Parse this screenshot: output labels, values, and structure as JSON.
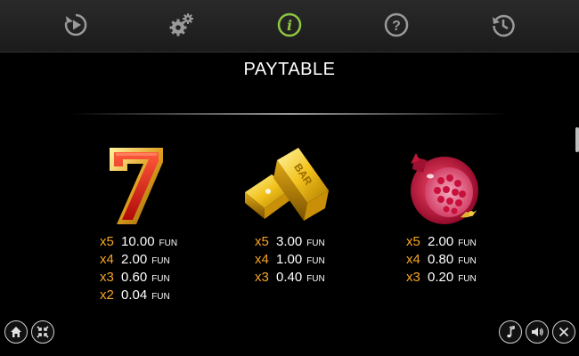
{
  "tabs": [
    {
      "icon": "replay-icon",
      "active": false
    },
    {
      "icon": "gears-icon",
      "active": false
    },
    {
      "icon": "info-icon",
      "active": true
    },
    {
      "icon": "help-icon",
      "active": false
    },
    {
      "icon": "history-icon",
      "active": false
    }
  ],
  "colors": {
    "active": "#8dc63f",
    "inactive": "#9a9a9a",
    "multiplier": "#f6a623"
  },
  "title": "PAYTABLE",
  "symbols": [
    {
      "name": "seven",
      "icon": "lucky-seven-icon",
      "pays": [
        {
          "mult": "x5",
          "amount": "10.00",
          "currency": "FUN"
        },
        {
          "mult": "x4",
          "amount": "2.00",
          "currency": "FUN"
        },
        {
          "mult": "x3",
          "amount": "0.60",
          "currency": "FUN"
        },
        {
          "mult": "x2",
          "amount": "0.04",
          "currency": "FUN"
        }
      ]
    },
    {
      "name": "gold-bar",
      "icon": "gold-bar-icon",
      "bar_text": "BAR",
      "pays": [
        {
          "mult": "x5",
          "amount": "3.00",
          "currency": "FUN"
        },
        {
          "mult": "x4",
          "amount": "1.00",
          "currency": "FUN"
        },
        {
          "mult": "x3",
          "amount": "0.40",
          "currency": "FUN"
        }
      ]
    },
    {
      "name": "pomegranate",
      "icon": "pomegranate-icon",
      "pays": [
        {
          "mult": "x5",
          "amount": "2.00",
          "currency": "FUN"
        },
        {
          "mult": "x4",
          "amount": "0.80",
          "currency": "FUN"
        },
        {
          "mult": "x3",
          "amount": "0.20",
          "currency": "FUN"
        }
      ]
    }
  ],
  "bottom_left": [
    {
      "icon": "home-icon"
    },
    {
      "icon": "collapse-icon"
    }
  ],
  "bottom_right": [
    {
      "icon": "music-icon"
    },
    {
      "icon": "sound-icon"
    },
    {
      "icon": "close-icon"
    }
  ]
}
